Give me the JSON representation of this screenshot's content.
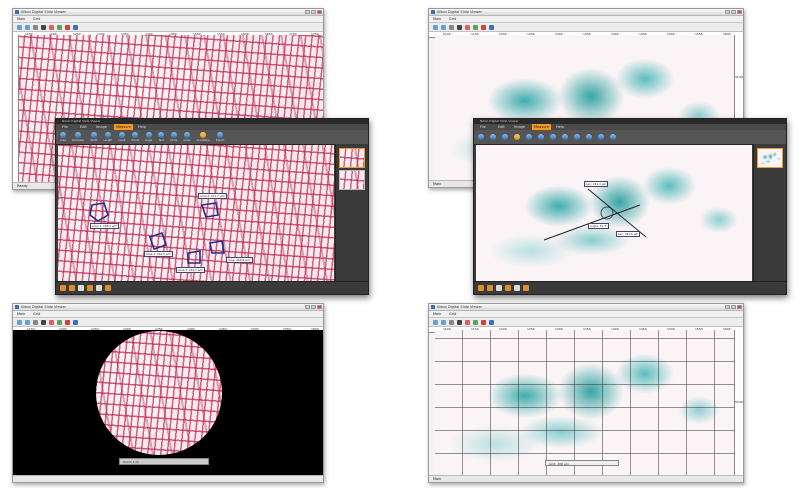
{
  "panels": {
    "top_left": {
      "title": "Nikon Digital Slide Viewer",
      "tabs": [
        "Main",
        "Grid"
      ],
      "ruler": [
        "1150",
        "1200",
        "1250",
        "1300",
        "1350",
        "1400",
        "1450",
        "1500",
        "1550",
        "1600",
        "1650",
        "1700",
        "1750"
      ],
      "status": "Ready"
    },
    "overlay_left": {
      "title": "Nikon Digital Slide Viewer",
      "menu": [
        "File",
        "Edit",
        "Image",
        "Measure",
        "Help"
      ],
      "tools": [
        "Area",
        "Perimeter",
        "Width",
        "Length",
        "Count",
        "Points",
        "Angle",
        "Text",
        "Circle",
        "Arrow",
        "Annotation",
        "Export"
      ],
      "active_tool": "Measure",
      "measure_labels": [
        "Area 1: 358.3 μm²",
        "Area 2: 242.0 μm²",
        "Area 3: 219.2 μm²",
        "Area 4: 311.7 μm²",
        "Area: 268.9 μm²"
      ]
    },
    "bottom_left": {
      "title": "Nikon Digital Slide Viewer",
      "tabs": [
        "Main",
        "Grid"
      ],
      "ruler": [
        "1150",
        "1200",
        "1250",
        "1300",
        "1350",
        "1400",
        "1450",
        "1500",
        "1550",
        "1600"
      ],
      "zoom_label": "Zoom 1.0x"
    },
    "top_right": {
      "title": "Nikon Digital Slide Viewer",
      "tabs": [
        "Main",
        "Grid"
      ],
      "ruler": [
        "1100",
        "1150",
        "1200",
        "1250",
        "1300",
        "1350",
        "1400",
        "1450",
        "1500",
        "1550",
        "1600"
      ],
      "side_value": "35.00",
      "status": "Main"
    },
    "overlay_right": {
      "title": "Nikon Digital Slide Viewer",
      "menu": [
        "File",
        "Edit",
        "Image",
        "Measure",
        "Help"
      ],
      "active_tool": "Measure",
      "measure_labels": [
        "Len: 241.4 μm",
        "Angle: 51.7°",
        "Len: 301.6 μm"
      ]
    },
    "bottom_right": {
      "title": "Nikon Digital Slide Viewer",
      "tabs": [
        "Main",
        "Grid"
      ],
      "ruler": [
        "1100",
        "1150",
        "1200",
        "1250",
        "1300",
        "1350",
        "1400",
        "1450",
        "1500",
        "1550",
        "1600"
      ],
      "side_value": "50.00",
      "grid_label": "Grid: 100 μm",
      "status": "Main"
    }
  },
  "colors": {
    "tissue_pink": "#c8285a",
    "stain_teal": "#1e9e9e",
    "measure_blue": "#1f2f8f",
    "accent_orange": "#f39a1e",
    "dark_ui": "#3c3c3c"
  }
}
